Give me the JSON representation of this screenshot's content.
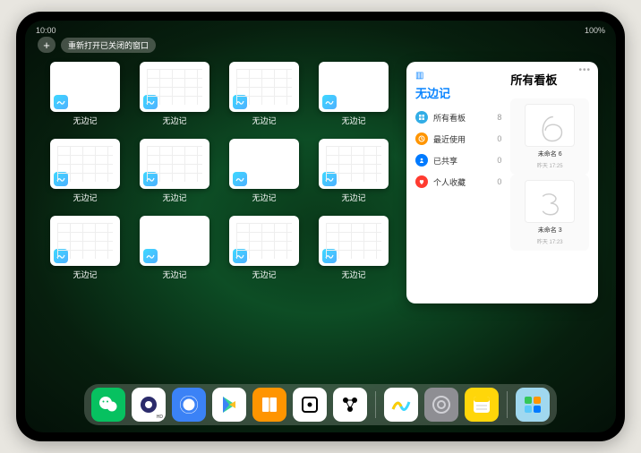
{
  "status": {
    "time": "10:00",
    "battery": "100%"
  },
  "toolbar": {
    "plus": "+",
    "reopen": "重新打开已关闭的窗口"
  },
  "windows": [
    {
      "label": "无边记",
      "type": "blank"
    },
    {
      "label": "无边记",
      "type": "table"
    },
    {
      "label": "无边记",
      "type": "table"
    },
    {
      "label": "无边记",
      "type": "blank"
    },
    {
      "label": "无边记",
      "type": "table"
    },
    {
      "label": "无边记",
      "type": "table"
    },
    {
      "label": "无边记",
      "type": "blank"
    },
    {
      "label": "无边记",
      "type": "table"
    },
    {
      "label": "无边记",
      "type": "table"
    },
    {
      "label": "无边记",
      "type": "blank"
    },
    {
      "label": "无边记",
      "type": "table"
    },
    {
      "label": "无边记",
      "type": "table"
    }
  ],
  "panel": {
    "left_title": "无边记",
    "right_title": "所有看板",
    "categories": [
      {
        "icon": "grid",
        "color": "#32ade6",
        "label": "所有看板",
        "count": "8"
      },
      {
        "icon": "clock",
        "color": "#ff9500",
        "label": "最近使用",
        "count": "0"
      },
      {
        "icon": "share",
        "color": "#007aff",
        "label": "已共享",
        "count": "0"
      },
      {
        "icon": "heart",
        "color": "#ff3b30",
        "label": "个人收藏",
        "count": "0"
      }
    ],
    "boards": [
      {
        "label": "未命名 6",
        "sub": "昨天 17:25",
        "sketch": "6"
      },
      {
        "label": "未命名 3",
        "sub": "昨天 17:23",
        "sketch": "3"
      }
    ]
  },
  "dock": [
    {
      "name": "wechat",
      "bg": "#07c160"
    },
    {
      "name": "quark",
      "bg": "#ffffff"
    },
    {
      "name": "qq-browser",
      "bg": "#3b82f6"
    },
    {
      "name": "play",
      "bg": "#ffffff"
    },
    {
      "name": "books",
      "bg": "#ff9500"
    },
    {
      "name": "dice",
      "bg": "#ffffff"
    },
    {
      "name": "nodes",
      "bg": "#ffffff"
    },
    {
      "name": "freeform",
      "bg": "#ffffff"
    },
    {
      "name": "settings",
      "bg": "#8e8e93"
    },
    {
      "name": "notes",
      "bg": "#ffd60a"
    },
    {
      "name": "widgets",
      "bg": "#a0d8ef"
    }
  ]
}
